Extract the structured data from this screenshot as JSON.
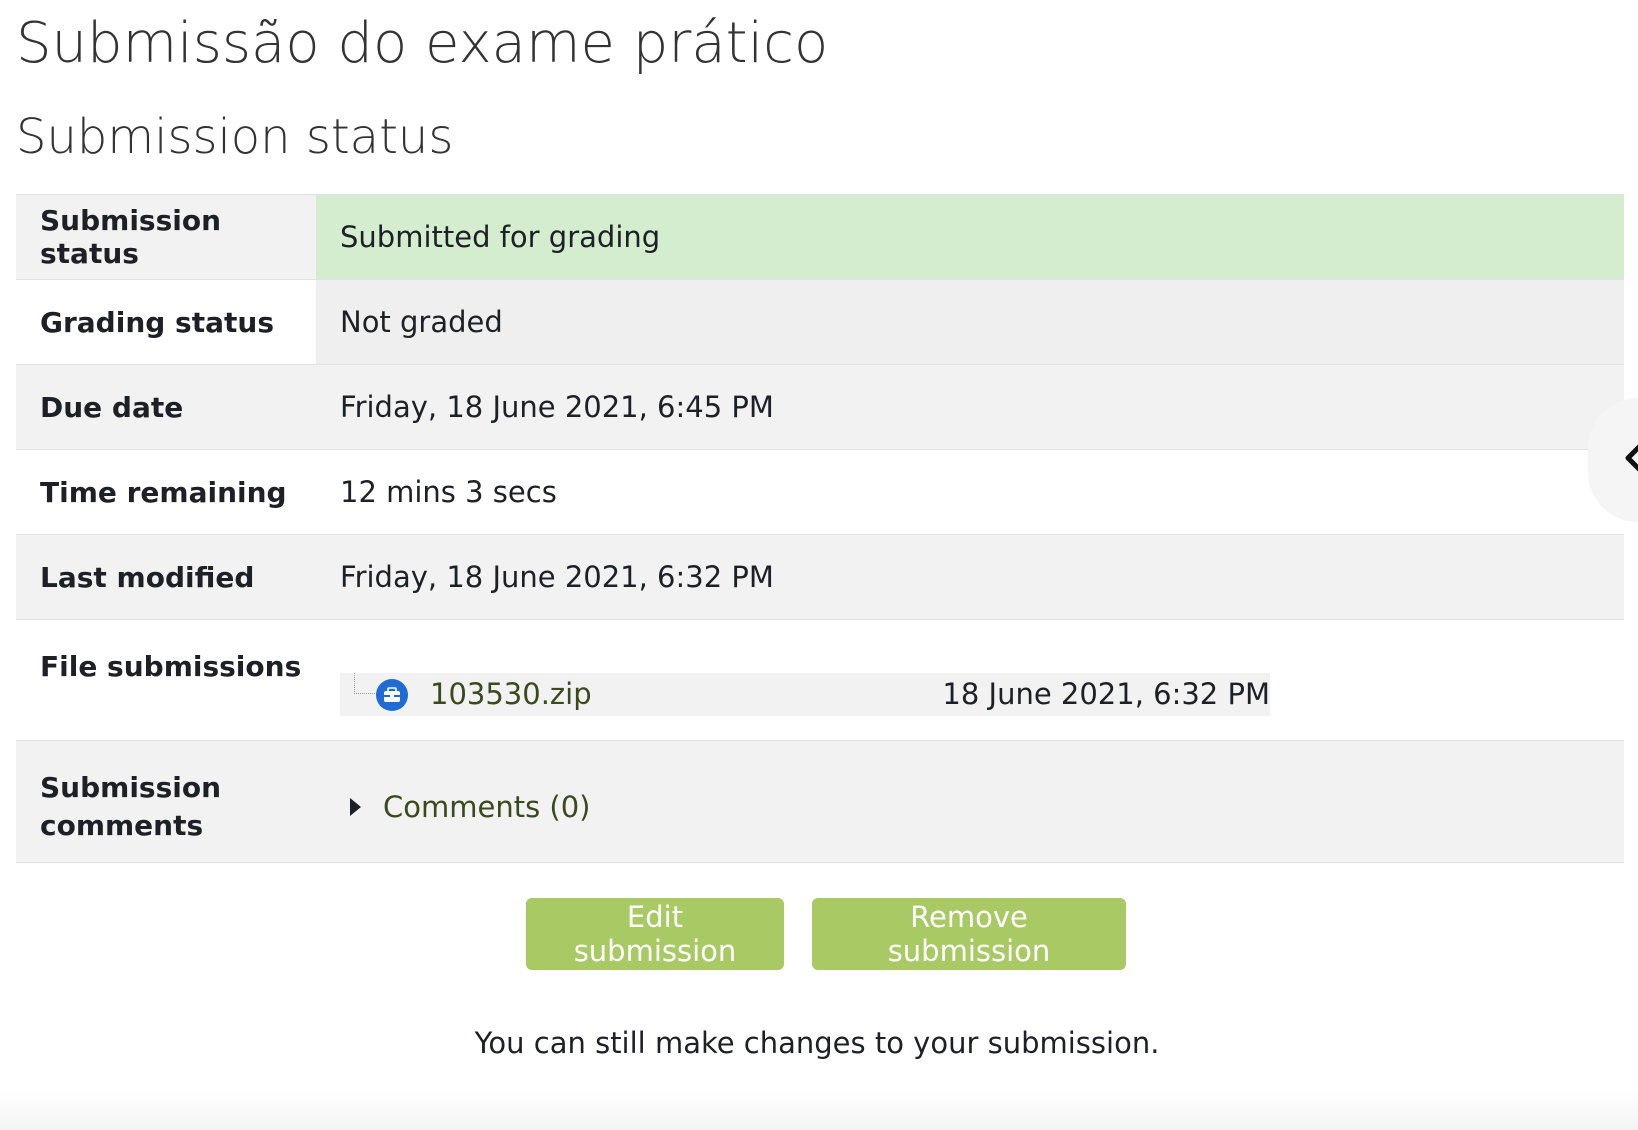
{
  "page": {
    "title": "Submissão do exame prático",
    "section_title": "Submission status"
  },
  "status_table": {
    "rows": [
      {
        "label": "Submission status",
        "value": "Submitted for grading"
      },
      {
        "label": "Grading status",
        "value": "Not graded"
      },
      {
        "label": "Due date",
        "value": "Friday, 18 June 2021, 6:45 PM"
      },
      {
        "label": "Time remaining",
        "value": "12 mins 3 secs"
      },
      {
        "label": "Last modified",
        "value": "Friday, 18 June 2021, 6:32 PM"
      },
      {
        "label": "File submissions",
        "file": {
          "name": "103530.zip",
          "date": "18 June 2021, 6:32 PM",
          "icon": "zip-file-icon"
        }
      },
      {
        "label": "Submission comments",
        "comments_link": "Comments (0)"
      }
    ]
  },
  "actions": {
    "edit_label": "Edit submission",
    "remove_label": "Remove submission"
  },
  "help_text": "You can still make changes to your submission.",
  "colors": {
    "submitted_bg": "#d4edcf",
    "button_bg": "#a8c964",
    "link_color": "#3a4a1e"
  },
  "icons": {
    "drawer_toggle": "chevron-left-icon",
    "expand": "caret-right-icon"
  }
}
